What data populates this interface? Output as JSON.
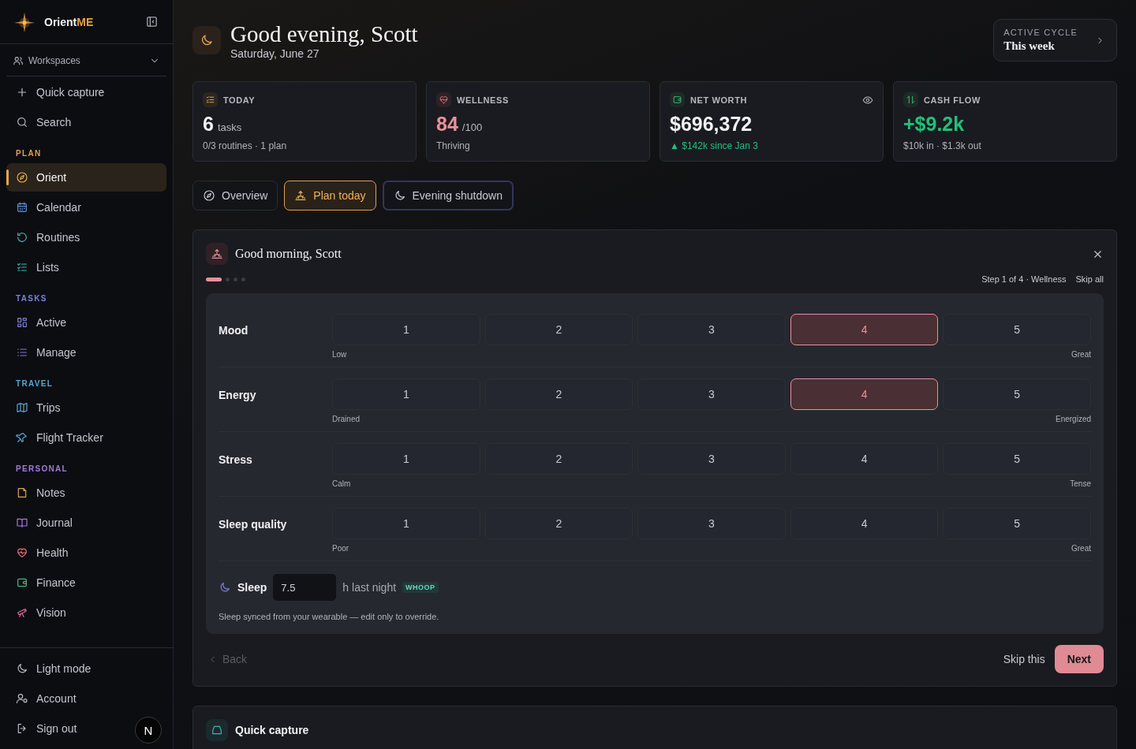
{
  "sidebar": {
    "brand": {
      "name": "Orient",
      "accent": "ME"
    },
    "workspaces": {
      "label": "Workspaces"
    },
    "actions": [
      {
        "label": "Quick capture"
      },
      {
        "label": "Search"
      }
    ],
    "sections": [
      {
        "title": "PLAN",
        "color": "#e0a050",
        "items": [
          {
            "label": "Orient",
            "selected": true
          },
          {
            "label": "Calendar",
            "selected": false
          },
          {
            "label": "Routines",
            "selected": false
          },
          {
            "label": "Lists",
            "selected": false
          }
        ]
      },
      {
        "title": "TASKS",
        "color": "#7b80d8",
        "items": [
          {
            "label": "Active",
            "selected": false
          },
          {
            "label": "Manage",
            "selected": false
          }
        ]
      },
      {
        "title": "TRAVEL",
        "color": "#5aa5d6",
        "items": [
          {
            "label": "Trips",
            "selected": false
          },
          {
            "label": "Flight Tracker",
            "selected": false
          }
        ]
      },
      {
        "title": "PERSONAL",
        "color": "#a27ad8",
        "items": [
          {
            "label": "Notes",
            "selected": false
          },
          {
            "label": "Journal",
            "selected": false
          },
          {
            "label": "Health",
            "selected": false
          },
          {
            "label": "Finance",
            "selected": false
          },
          {
            "label": "Vision",
            "selected": false
          }
        ]
      }
    ],
    "footer": [
      {
        "label": "Light mode"
      },
      {
        "label": "Account"
      },
      {
        "label": "Sign out"
      }
    ],
    "dev_badge": "N"
  },
  "header": {
    "title": "Good evening, Scott",
    "date": "Saturday, June 27",
    "cycle": {
      "label": "ACTIVE CYCLE",
      "value": "This week"
    }
  },
  "stats": [
    {
      "label": "TODAY",
      "value": "6",
      "unit": "tasks",
      "sub": "0/3 routines · 1 plan",
      "color": "#f2f2f4",
      "sub_positive": false,
      "hideable": false
    },
    {
      "label": "WELLNESS",
      "value": "84",
      "unit": "/100",
      "sub": "Thriving",
      "color": "#e8909a",
      "sub_positive": false,
      "hideable": false
    },
    {
      "label": "NET WORTH",
      "value": "$696,372",
      "sub": "▲ $142k since Jan 3",
      "color": "#f2f2f4",
      "sub_positive": true,
      "hideable": true
    },
    {
      "label": "CASH FLOW",
      "value": "+$9.2k",
      "sub": "$10k in · $1.3k out",
      "color": "#22c07a",
      "sub_positive": false,
      "hideable": false
    }
  ],
  "tabs": [
    {
      "label": "Overview",
      "selected": false,
      "focused": false
    },
    {
      "label": "Plan today",
      "selected": true,
      "focused": false
    },
    {
      "label": "Evening shutdown",
      "selected": false,
      "focused": true
    }
  ],
  "checkin": {
    "title": "Good morning, Scott",
    "steps": [
      {
        "selected": true
      },
      {
        "selected": false
      },
      {
        "selected": false
      },
      {
        "selected": false
      }
    ],
    "step_text": "Step 1 of 4 · Wellness",
    "skip_all": "Skip all",
    "scales": [
      {
        "label": "Mood",
        "low": "Low",
        "high": "Great",
        "options": [
          {
            "label": "1",
            "selected": false
          },
          {
            "label": "2",
            "selected": false
          },
          {
            "label": "3",
            "selected": false
          },
          {
            "label": "4",
            "selected": true
          },
          {
            "label": "5",
            "selected": false
          }
        ]
      },
      {
        "label": "Energy",
        "low": "Drained",
        "high": "Energized",
        "options": [
          {
            "label": "1",
            "selected": false
          },
          {
            "label": "2",
            "selected": false
          },
          {
            "label": "3",
            "selected": false
          },
          {
            "label": "4",
            "selected": true
          },
          {
            "label": "5",
            "selected": false
          }
        ]
      },
      {
        "label": "Stress",
        "low": "Calm",
        "high": "Tense",
        "options": [
          {
            "label": "1",
            "selected": false
          },
          {
            "label": "2",
            "selected": false
          },
          {
            "label": "3",
            "selected": false
          },
          {
            "label": "4",
            "selected": false
          },
          {
            "label": "5",
            "selected": false
          }
        ]
      },
      {
        "label": "Sleep quality",
        "low": "Poor",
        "high": "Great",
        "options": [
          {
            "label": "1",
            "selected": false
          },
          {
            "label": "2",
            "selected": false
          },
          {
            "label": "3",
            "selected": false
          },
          {
            "label": "4",
            "selected": false
          },
          {
            "label": "5",
            "selected": false
          }
        ]
      }
    ],
    "sleep": {
      "label": "Sleep",
      "value": "7.5",
      "unit": "h last night",
      "source": "WHOOP",
      "note": "Sleep synced from your wearable — edit only to override."
    },
    "back": {
      "label": "Back",
      "disabled": true
    },
    "skip": "Skip this",
    "next": "Next"
  },
  "next_card": {
    "title": "Quick capture"
  }
}
